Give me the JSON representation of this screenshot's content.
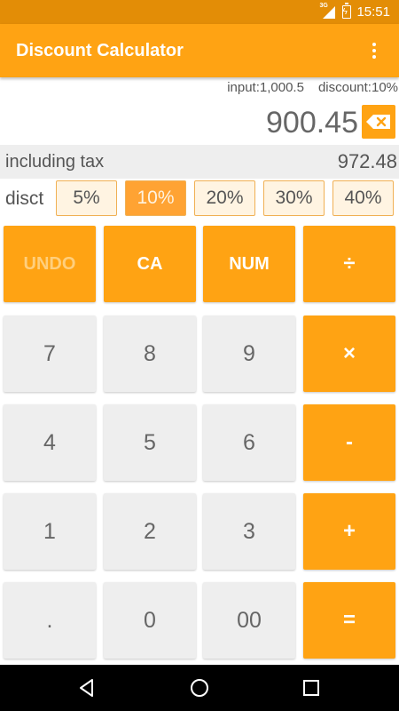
{
  "status_bar": {
    "time": "15:51",
    "network_tag": "3G",
    "icons": [
      "signal-icon",
      "battery-charging-icon"
    ]
  },
  "app_bar": {
    "title": "Discount Calculator",
    "menu_icon": "overflow-menu-icon"
  },
  "display": {
    "input_text": "input:1,000.5",
    "discount_text": "discount:10%",
    "result": "900.45",
    "backspace_icon": "backspace-icon",
    "tax_label": "including tax",
    "tax_value": "972.48"
  },
  "discount_bar": {
    "label": "disct",
    "options": [
      "5%",
      "10%",
      "20%",
      "30%",
      "40%"
    ],
    "selected": "10%"
  },
  "keypad": {
    "undo": "UNDO",
    "ca": "CA",
    "num": "NUM",
    "divide": "÷",
    "k7": "7",
    "k8": "8",
    "k9": "9",
    "multiply": "×",
    "k4": "4",
    "k5": "5",
    "k6": "6",
    "minus": "-",
    "k1": "1",
    "k2": "2",
    "k3": "3",
    "plus": "+",
    "dot": ".",
    "k0": "0",
    "k00": "00",
    "equals": "="
  },
  "nav_bar": {
    "icons": [
      "back-icon",
      "home-icon",
      "recents-icon"
    ]
  },
  "colors": {
    "accent": "#ffa313",
    "status_bar": "#e38d06",
    "selected_discount": "#ffa333",
    "key_background": "#eeeeee"
  }
}
